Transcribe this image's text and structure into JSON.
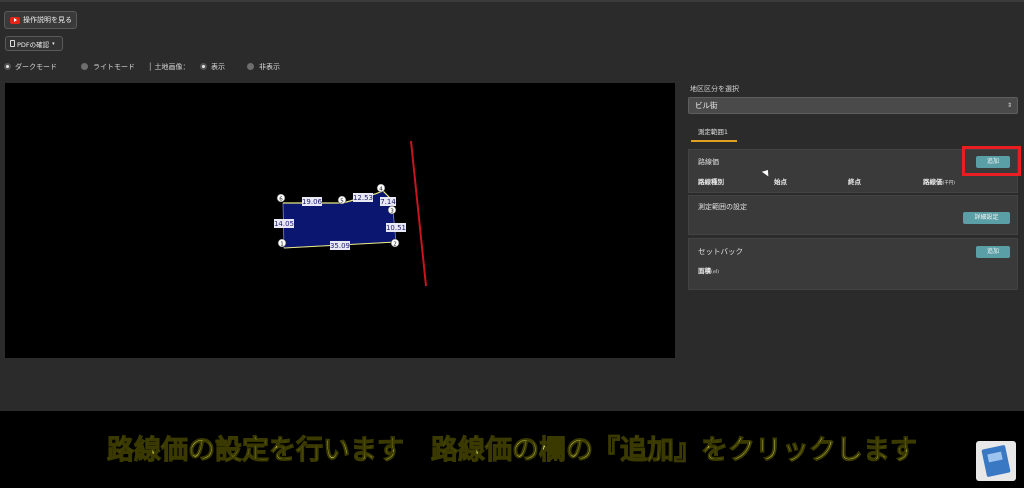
{
  "toolbar": {
    "video_label": "操作説明を見る",
    "pdf_label": "PDFの確認"
  },
  "mode": {
    "dark": "ダークモード",
    "light": "ライトモード",
    "land_image_label": "│ 土地画像：",
    "show": "表示",
    "hide": "非表示",
    "selected_mode": "dark",
    "selected_image": "show"
  },
  "plot": {
    "edges": [
      "19.06",
      "12.53",
      "7.14",
      "10.51",
      "35.09",
      "14.05"
    ],
    "vertex_numbers": [
      "6",
      "5",
      "4",
      "3",
      "2",
      "1"
    ],
    "polygon_fill": "#0b1670",
    "edge_color": "#e8e880",
    "road_line_color": "#c8141e"
  },
  "right": {
    "select_label": "地区区分を選択",
    "select_value": "ビル街",
    "tab_label": "測定範囲1",
    "route_price": {
      "title": "路線価",
      "add_button": "追加",
      "columns": [
        "路線種別",
        "始点",
        "終点",
        "路線価"
      ],
      "price_unit": "(千円)"
    },
    "range_settings": {
      "title": "測定範囲の設定",
      "detail_button": "詳細設定"
    },
    "setback": {
      "title": "セットバック",
      "add_button": "追加",
      "area_label": "面積",
      "area_unit": "(㎡)"
    }
  },
  "caption": "路線価の設定を行います　路線価の欄の『追加』をクリックします",
  "colors": {
    "accent_teal": "#5b9fa6",
    "highlight_red": "#ea1c24",
    "caption_yellow": "#f4f55d",
    "tab_underline": "#e0a020"
  }
}
